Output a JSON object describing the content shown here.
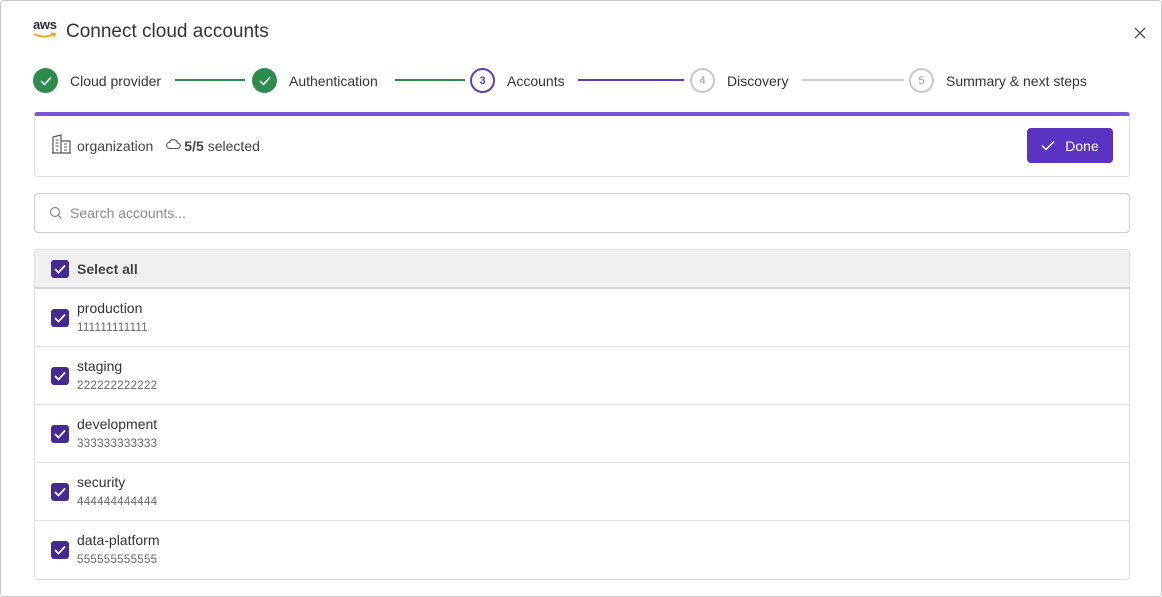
{
  "header": {
    "logo_text": "aws",
    "title": "Connect cloud accounts"
  },
  "stepper": {
    "steps": [
      {
        "number": "",
        "label": "Cloud provider",
        "state": "done"
      },
      {
        "number": "",
        "label": "Authentication",
        "state": "done"
      },
      {
        "number": "3",
        "label": "Accounts",
        "state": "active"
      },
      {
        "number": "4",
        "label": "Discovery",
        "state": "pending"
      },
      {
        "number": "5",
        "label": "Summary & next steps",
        "state": "pending"
      }
    ]
  },
  "infobar": {
    "org_label": "organization",
    "selected_count": "5/5",
    "selected_text": "selected",
    "done_label": "Done"
  },
  "search": {
    "placeholder": "Search accounts..."
  },
  "list": {
    "select_all_label": "Select all",
    "accounts": [
      {
        "name": "production",
        "id": "111111111111"
      },
      {
        "name": "staging",
        "id": "222222222222"
      },
      {
        "name": "development",
        "id": "333333333333"
      },
      {
        "name": "security",
        "id": "444444444444"
      },
      {
        "name": "data-platform",
        "id": "555555555555"
      }
    ]
  },
  "colors": {
    "done_green": "#2e8b4e",
    "active_purple": "#5b3cc4",
    "button_purple": "#5b33c2",
    "checkbox_purple": "#452a8f"
  }
}
